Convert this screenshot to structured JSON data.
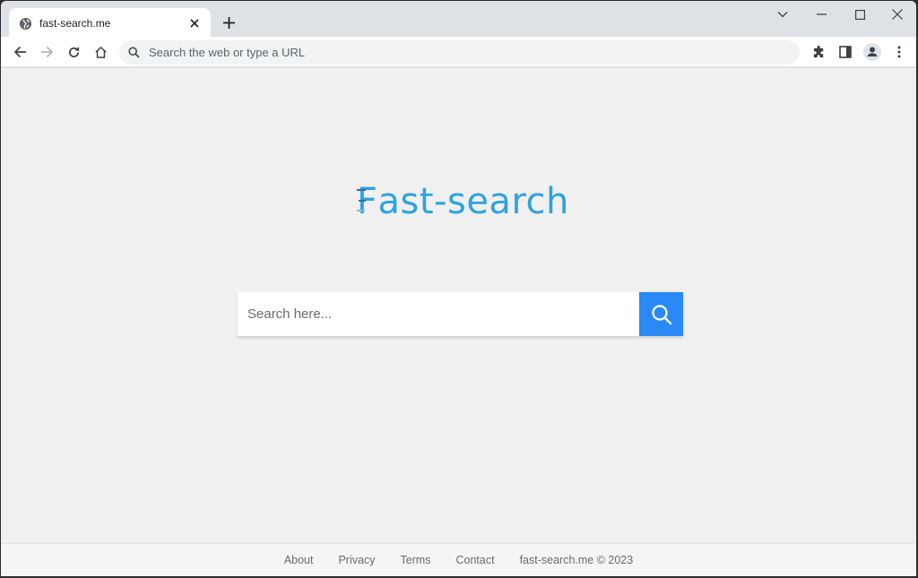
{
  "browser": {
    "tab": {
      "title": "fast-search.me",
      "favicon": "globe-icon"
    },
    "new_tab_icon": "plus-icon",
    "window_controls": [
      "tab-search-icon",
      "minimize-icon",
      "maximize-icon",
      "close-icon"
    ],
    "toolbar": {
      "back_icon": "arrow-left-icon",
      "forward_icon": "arrow-right-icon",
      "reload_icon": "reload-icon",
      "home_icon": "home-icon",
      "omnibox": {
        "placeholder": "Search the web or type a URL",
        "value": ""
      },
      "extensions_icon": "puzzle-icon",
      "side_panel_icon": "side-panel-icon",
      "profile_icon": "avatar-icon",
      "menu_icon": "kebab-menu-icon"
    }
  },
  "page": {
    "logo": {
      "first_letter": "F",
      "rest": "ast-search"
    },
    "search": {
      "placeholder": "Search here...",
      "value": "",
      "button_icon": "search-icon"
    },
    "colors": {
      "logo": "#2ea3dd",
      "button": "#2a88f7",
      "background": "#f0f0f0"
    },
    "footer": {
      "links": [
        {
          "label": "About"
        },
        {
          "label": "Privacy"
        },
        {
          "label": "Terms"
        },
        {
          "label": "Contact"
        }
      ],
      "copyright": "fast-search.me © 2023"
    }
  }
}
